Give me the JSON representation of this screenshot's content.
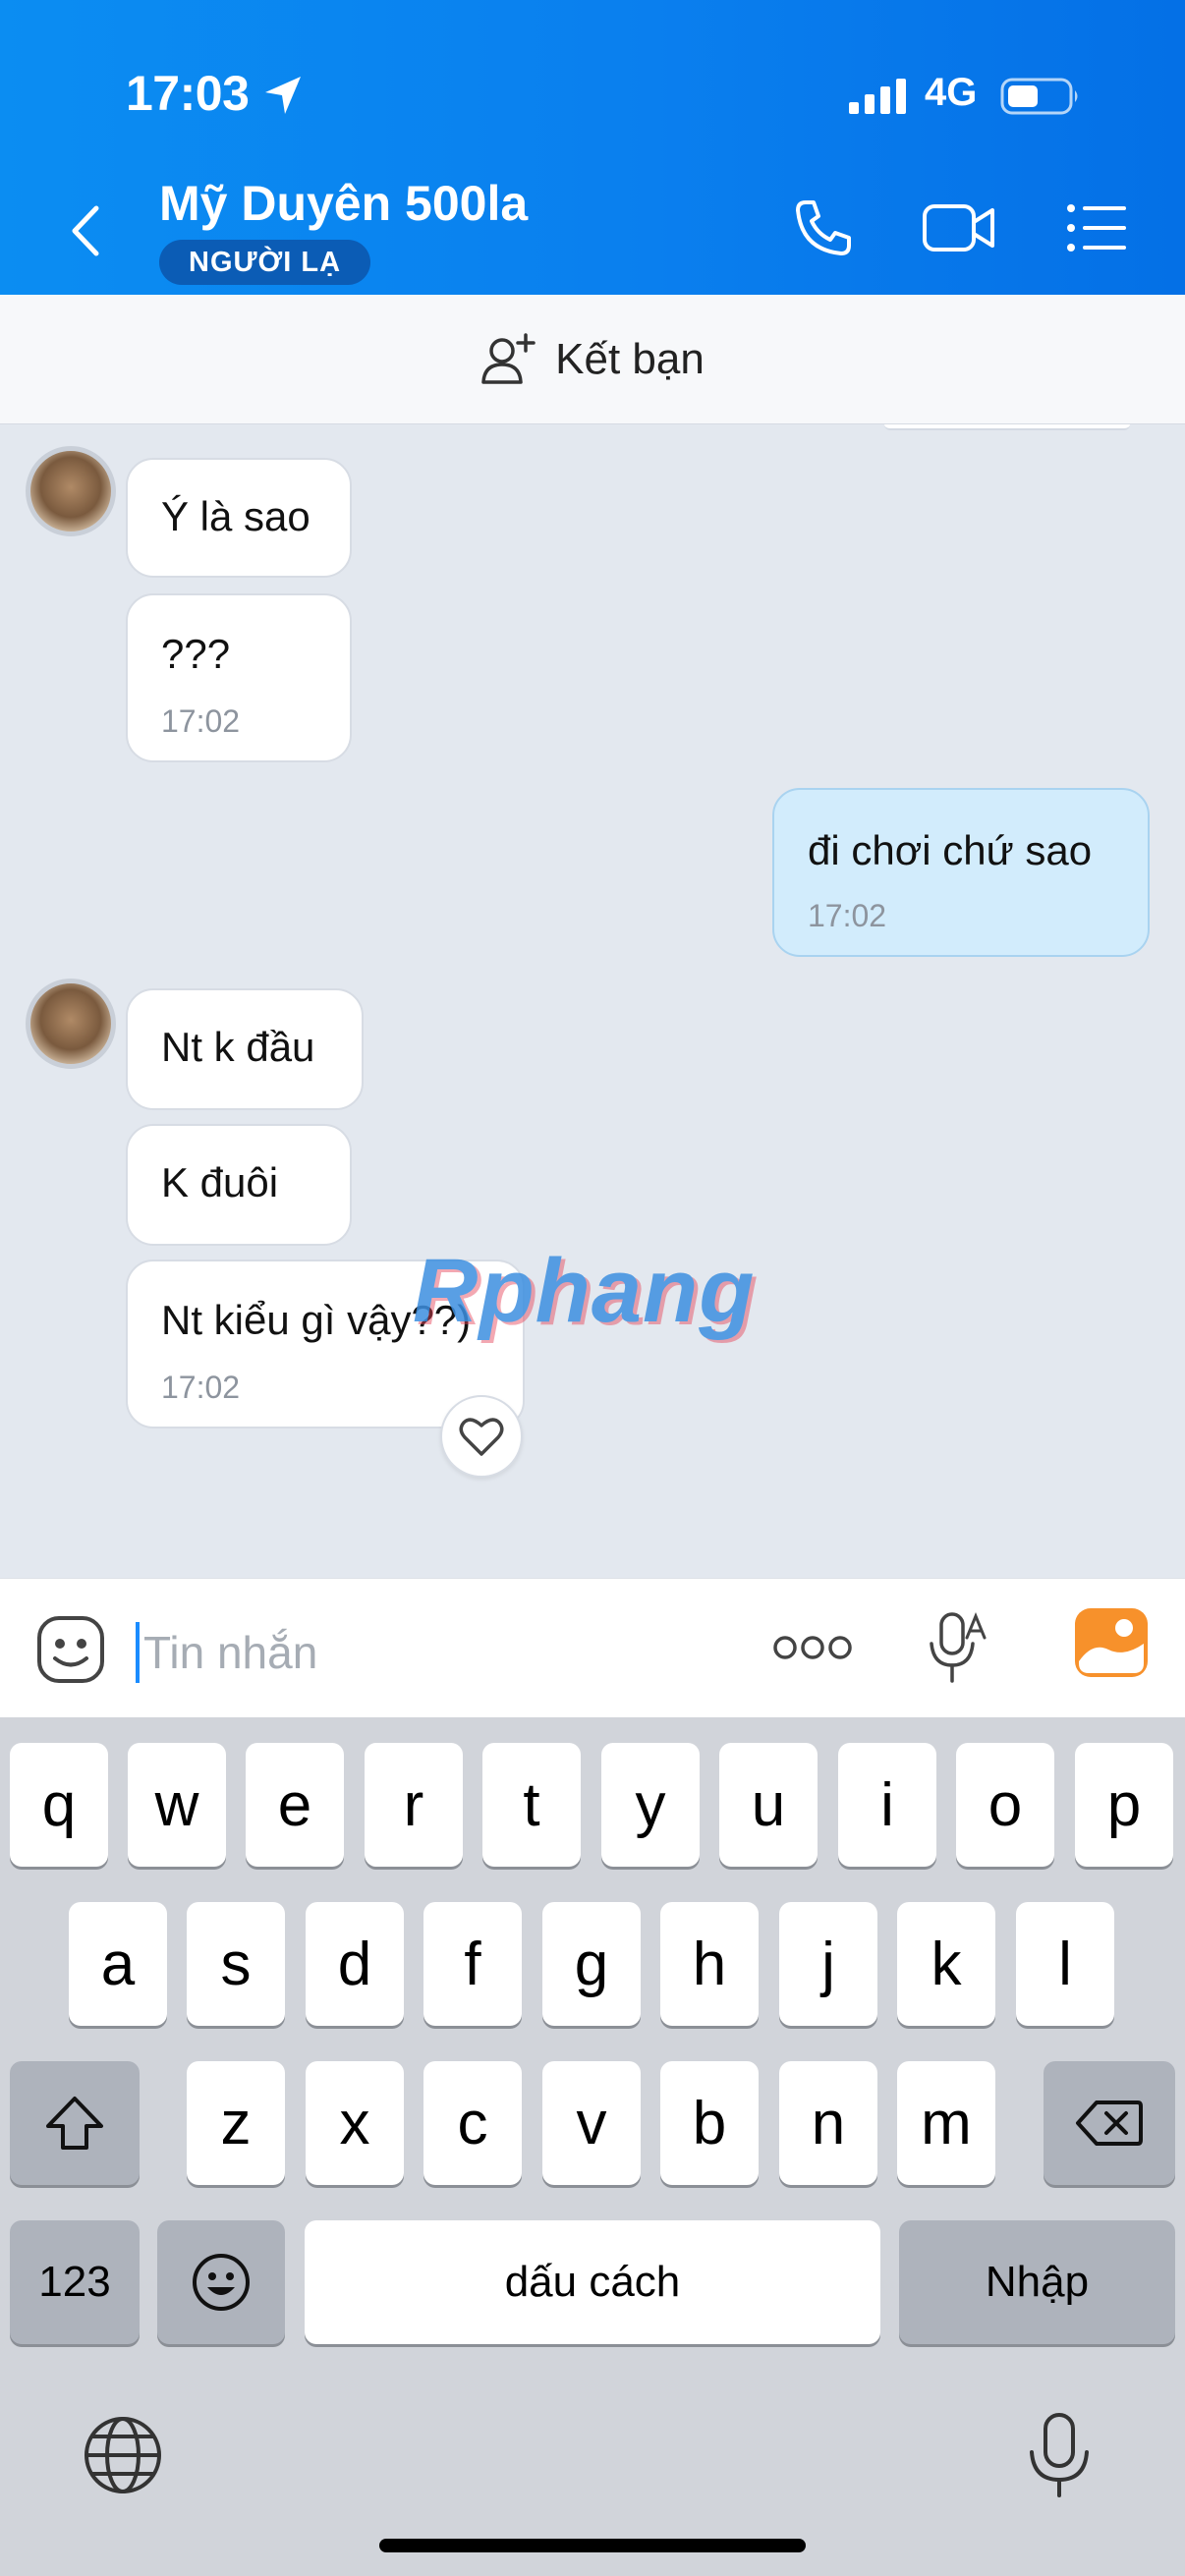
{
  "status_bar": {
    "time": "17:03",
    "network": "4G"
  },
  "header": {
    "contact_name": "Mỹ Duyên 500la",
    "badge": "NGƯỜI LẠ"
  },
  "friend_bar": {
    "label": "Kết bạn"
  },
  "messages": [
    {
      "side": "in",
      "text": "Ý là sao",
      "time": ""
    },
    {
      "side": "in",
      "text": "???",
      "time": "17:02"
    },
    {
      "side": "out",
      "text": "đi chơi chứ sao",
      "time": "17:02"
    },
    {
      "side": "in",
      "text": "Nt k đầu",
      "time": ""
    },
    {
      "side": "in",
      "text": "K đuôi",
      "time": ""
    },
    {
      "side": "in",
      "text": "Nt kiểu gì vậy??)",
      "time": "17:02"
    }
  ],
  "watermark": "Rphang",
  "composer": {
    "placeholder": "Tin nhắn"
  },
  "keyboard": {
    "row1": [
      "q",
      "w",
      "e",
      "r",
      "t",
      "y",
      "u",
      "i",
      "o",
      "p"
    ],
    "row2": [
      "a",
      "s",
      "d",
      "f",
      "g",
      "h",
      "j",
      "k",
      "l"
    ],
    "row3": [
      "z",
      "x",
      "c",
      "v",
      "b",
      "n",
      "m"
    ],
    "numbers_label": "123",
    "space_label": "dấu cách",
    "return_label": "Nhập"
  },
  "colors": {
    "header_blue": "#0a7fee",
    "outgoing_bubble": "#d2ecfc",
    "chat_bg": "#e3e8ef"
  }
}
